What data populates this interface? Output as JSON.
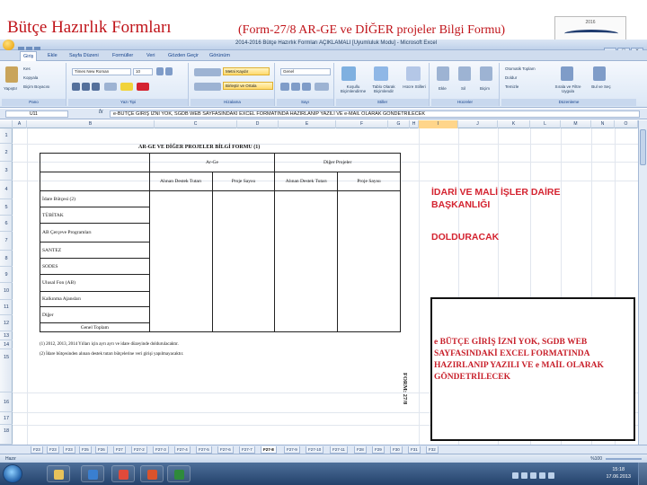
{
  "slide": {
    "title": "Bütçe Hazırlık Formları",
    "subtitle": "(Form-27/8 AR-GE ve DİĞER projeler Bilgi Formu)",
    "logo_year": "2016"
  },
  "window": {
    "caption": "2014-2016 Bütçe Hazırlık Formları AÇIKLAMALI [Uyumluluk Modu] - Microsoft Excel",
    "buttons": [
      "–",
      "□",
      "×"
    ]
  },
  "ribbon_tabs": [
    "Giriş",
    "Ekle",
    "Sayfa Düzeni",
    "Formüller",
    "Veri",
    "Gözden Geçir",
    "Görünüm"
  ],
  "ribbon": {
    "clipboard": {
      "label": "Pano",
      "paste": "Yapıştır",
      "cut": "Kes",
      "copy": "Kopyala",
      "format_painter": "Biçim Boyacısı"
    },
    "font": {
      "label": "Yazı Tipi",
      "name": "Times New Roman",
      "size": "10"
    },
    "alignment": {
      "label": "Hizalama",
      "wrap": "Metni Kaydır",
      "merge": "Birleştir ve Ortala"
    },
    "number": {
      "label": "Sayı",
      "format": "Genel"
    },
    "styles": {
      "label": "Stiller",
      "conditional": "Koşullu Biçimlendirme",
      "table": "Tablo Olarak Biçimlendir",
      "cell": "Hücre Stilleri"
    },
    "cells": {
      "label": "Hücreler",
      "insert": "Ekle",
      "delete": "Sil",
      "format": "Biçim"
    },
    "editing": {
      "label": "Düzenleme",
      "autosum": "Otomatik Toplam",
      "fill": "Doldur",
      "clear": "Temizle",
      "sort": "Sırala ve Filtre Uygula",
      "find": "Bul ve Seç"
    }
  },
  "formula_bar": {
    "cell_ref": "U11",
    "fx": "fx",
    "content": "e-BÜTÇE GİRİŞ İZNİ YOK, SGDB WEB SAYFASINDAKİ EXCEL FORMATINDA HAZIRLANIP YAZILI VE e-MAİL OLARAK GÖNDETRİLECEK"
  },
  "columns": [
    "A",
    "B",
    "C",
    "D",
    "E",
    "F",
    "G",
    "H",
    "I",
    "J",
    "K",
    "L",
    "M",
    "N",
    "O"
  ],
  "selected_column": "I",
  "rows": [
    "1",
    "2",
    "3",
    "4",
    "5",
    "6",
    "7",
    "8",
    "9",
    "10",
    "11",
    "12",
    "13",
    "14",
    "15",
    "16",
    "17",
    "18"
  ],
  "form": {
    "title": "AR-GE VE DİĞER PROJELER BİLGİ FORMU (1)",
    "group_headers": [
      "Ar-Ge",
      "Diğer Projeler"
    ],
    "sub_headers": [
      "Alınan Destek Tutarı",
      "Proje Sayısı",
      "Alınan Destek Tutarı",
      "Proje Sayısı"
    ],
    "row_labels": [
      "İdare Bütçesi (2)",
      "TÜBİTAK",
      "AB Çerçeve Programları",
      "SANTEZ",
      "SODES",
      "Ulusal Fon (AB)",
      "Kalkınma Ajansları",
      "Diğer"
    ],
    "total_label": "Genel Toplam",
    "notes": [
      "(1) 2012, 2013, 2014 Yılları için ayrı ayrı ve idare düzeyinde doldurulacaktır.",
      "(2) İdare bütçesinden alınan destek tutarı bütçelerine veri girişi yapılmayacaktır."
    ],
    "form_code": "FORM: 27/8"
  },
  "side_notes": {
    "dept": "İDARİ VE MALİ İŞLER DAİRE BAŞKANLIĞI",
    "dolduracak": "DOLDURACAK",
    "box": "e BÜTÇE GİRİŞ İZNİ YOK, SGDB WEB SAYFASINDAKİ EXCEL FORMATINDA HAZIRLANIP YAZILI VE e MAİL OLARAK GÖNDETRİLECEK"
  },
  "sheet_tabs": [
    "F23",
    "F23",
    "F23",
    "F25",
    "F26",
    "F27",
    "F27-2",
    "F27-3",
    "F27-4",
    "F27-5",
    "F27-6",
    "F27-7",
    "F27-8",
    "F27-9",
    "F27-10",
    "F27-11",
    "F28",
    "F29",
    "F30",
    "F31",
    "F32"
  ],
  "active_sheet": "F27-8",
  "status": {
    "ready": "Hazır",
    "zoom": "%100"
  },
  "taskbar": {
    "time": "15:18",
    "date": "17.06.2013",
    "apps": [
      {
        "name": "explorer-icon",
        "color": "#e8c25a"
      },
      {
        "name": "media-player-icon",
        "color": "#3a7fd0"
      },
      {
        "name": "chrome-icon",
        "color": "#e04a3a"
      },
      {
        "name": "powerpoint-icon",
        "color": "#d9532c"
      },
      {
        "name": "excel-icon",
        "color": "#2f8a3b"
      }
    ]
  },
  "colors": {
    "title_red": "#c0141a",
    "note_red": "#d42330",
    "accent_blue": "#15428b"
  }
}
